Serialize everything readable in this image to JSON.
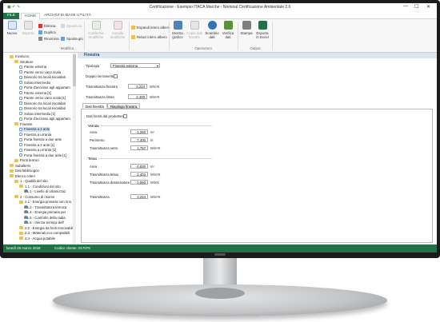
{
  "window": {
    "title": "Certificazione - Esempio ITACA Marche - Nominal Certificazione Ambientale 2.6",
    "controls": [
      "—",
      "☐",
      "✕"
    ]
  },
  "ribbon": {
    "tabs": [
      "FILE",
      "HOME",
      "ARCHIVI DI BASE",
      "UTILITÀ"
    ],
    "buttons": {
      "nuovo": "Nuovo",
      "importa": "Importa",
      "elimina": "Elimina",
      "duplica": "Duplica",
      "rinomina": "Rinomina",
      "sposta_su": "Sposta su",
      "sposta_giu": "Sposta giù",
      "conferma": "Conferma modifiche",
      "annulla": "Annulla modifiche",
      "espandi": "Espandi intero albero",
      "riduci": "Riduci intero albero",
      "mostra_grafico": "Mostra grafico",
      "copia_dati": "Copia dati finestre",
      "scambio_dati": "Scambio dati",
      "verifica_dati": "Verifica dati",
      "stampa": "Stampa",
      "esporta_excel": "Esporta in Excel"
    },
    "groups": {
      "modifica": "Modifica",
      "operazioni": "Operazioni",
      "output": "Output"
    }
  },
  "tree": {
    "items": [
      {
        "label": "Involucro",
        "type": "folder"
      },
      {
        "label": "Strutture",
        "type": "folder"
      },
      {
        "label": "Parete esterna",
        "type": "doc"
      },
      {
        "label": "Parete verso vano scala",
        "type": "doc"
      },
      {
        "label": "Divisorio tra locali riscaldati",
        "type": "doc"
      },
      {
        "label": "Solaio intermedio",
        "type": "doc"
      },
      {
        "label": "Porta d'accesso agli appartam.",
        "type": "doc"
      },
      {
        "label": "Parete esterna [1]",
        "type": "doc"
      },
      {
        "label": "Parete verso vano scala [1]",
        "type": "doc"
      },
      {
        "label": "Divisorio tra locali riscaldati",
        "type": "doc"
      },
      {
        "label": "Divisorio tra locali riscaldati",
        "type": "doc"
      },
      {
        "label": "Solaio intermedio [1]",
        "type": "doc"
      },
      {
        "label": "Porta d'accesso agli appartam.",
        "type": "doc"
      },
      {
        "label": "Finestre",
        "type": "folder"
      },
      {
        "label": "Finestra a 2 ante",
        "type": "doc"
      },
      {
        "label": "Finestra a un'anta",
        "type": "doc"
      },
      {
        "label": "Porta finestra a due ante",
        "type": "doc"
      },
      {
        "label": "Finestra a 2 ante [1]",
        "type": "doc"
      },
      {
        "label": "Finestra a un'anta [1]",
        "type": "doc"
      },
      {
        "label": "Porta finestra a due ante [1]",
        "type": "doc"
      },
      {
        "label": "Ponti termici",
        "type": "folder"
      },
      {
        "label": "Subalterni",
        "type": "folder"
      },
      {
        "label": "Dati fabbisogno",
        "type": "folder"
      },
      {
        "label": "Elenco criteri",
        "type": "folder"
      },
      {
        "label": "1 - Qualità del sito",
        "type": "folder"
      },
      {
        "label": "1.1 - Condizioni del sito",
        "type": "folder"
      },
      {
        "label": "1.1.1 - Livello di urbanizzaz.",
        "type": "check"
      },
      {
        "label": "2 - Consumo di risorse",
        "type": "folder"
      },
      {
        "label": "2.1 - Energia primaria non rinn.",
        "type": "folder"
      },
      {
        "label": "2.1.2 - Trasmittanza termica",
        "type": "check"
      },
      {
        "label": "2.1.4 - Energia primaria per",
        "type": "check"
      },
      {
        "label": "2.1.5 - Controllo della radia.",
        "type": "check"
      },
      {
        "label": "2.1.6 - Inerzia termica dell'",
        "type": "check"
      },
      {
        "label": "2.2 - Energia da fonti rinnovabili",
        "type": "folder"
      },
      {
        "label": "2.3 - Materiali eco-compatibili",
        "type": "folder"
      },
      {
        "label": "2.4 - Acqua potabile",
        "type": "folder"
      }
    ]
  },
  "main": {
    "section_title": "Finestra",
    "tipologia_label": "Tipologia",
    "tipologia_value": "Finestra esterna",
    "doppio_serramento_label": "Doppio serramento",
    "trasmittanza_finestra_label": "Trasmittanza finestra",
    "trasmittanza_finestra_value": "2,224",
    "trasmittanza_limite_label": "Trasmittanza limite",
    "trasmittanza_limite_value": "2,400",
    "unit_wm2k": "W/m²K",
    "tabs": [
      "Dati finestra",
      "Riepilogo finestra"
    ],
    "dati_forniti_label": "Dati forniti dal produttore",
    "vetrata_title": "Vetrata",
    "area_label": "Area",
    "area_vetro_value": "1,260",
    "unit_m2": "m²",
    "perimetro_label": "Perimetro",
    "perimetro_value": "7,400",
    "unit_m": "m",
    "trasmittanza_vetro_label": "Trasmittanza vetro",
    "trasmittanza_vetro_value": "1,757",
    "telaio_title": "Telaio",
    "area_telaio_value": "0,830",
    "trasmittanza_telaio_label": "Trasmittanza telaio",
    "trasmittanza_telaio_value": "2,403",
    "trasmittanza_distanziatore_label": "Trasmittanza distanziatore",
    "trasmittanza_distanziatore_value": "0,060",
    "unit_wmk": "W/mK",
    "trasmittanza_label": "Trasmittanza",
    "trasmittanza_value": "2,224"
  },
  "status": {
    "date": "lunedì 26 marzo 2018",
    "client_code": "Codice cliente: 017076"
  }
}
